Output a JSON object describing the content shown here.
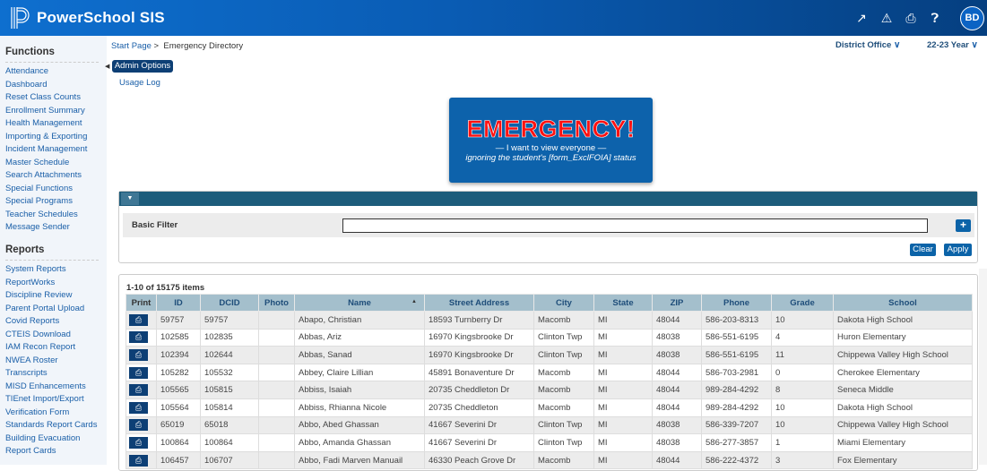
{
  "header": {
    "brand": "PowerSchool SIS",
    "icons": [
      "external-link-icon",
      "alert-icon",
      "print-icon",
      "help-icon"
    ],
    "avatar": "BD"
  },
  "sidebar": {
    "functions_title": "Functions",
    "functions": [
      "Attendance",
      "Dashboard",
      "Reset Class Counts",
      "Enrollment Summary",
      "Health Management",
      "Importing & Exporting",
      "Incident Management",
      "Master Schedule",
      "Search Attachments",
      "Special Functions",
      "Special Programs",
      "Teacher Schedules",
      "Message Sender"
    ],
    "reports_title": "Reports",
    "reports": [
      "System Reports",
      "ReportWorks",
      "Discipline Review",
      "Parent Portal Upload",
      "Covid Reports",
      "CTEIS Download",
      "IAM Recon Report",
      "NWEA Roster",
      "Transcripts",
      "MISD Enhancements",
      "TIEnet Import/Export",
      "Verification Form",
      "Standards Report Cards",
      "Building Evacuation",
      "Report Cards"
    ]
  },
  "breadcrumb": {
    "start": "Start Page",
    "sep": ">",
    "current": "Emergency Directory"
  },
  "context": {
    "school": "District Office",
    "year": "22-23 Year"
  },
  "admin_options": "Admin Options",
  "usage_log": "Usage Log",
  "banner": {
    "title": "EMERGENCY!",
    "line1": "— I want to view everyone —",
    "line2": "ignoring the student's [form_ExclFOIA] status"
  },
  "filter": {
    "label": "Basic Filter",
    "value": "",
    "add": "+",
    "clear": "Clear",
    "apply": "Apply"
  },
  "table": {
    "count": "1-10 of 15175 items",
    "columns": [
      "Print",
      "ID",
      "DCID",
      "Photo",
      "Name",
      "Street Address",
      "City",
      "State",
      "ZIP",
      "Phone",
      "Grade",
      "School"
    ],
    "sorted_column": "Name",
    "rows": [
      [
        "59757",
        "59757",
        "",
        "Abapo, Christian",
        "18593 Turnberry Dr",
        "Macomb",
        "MI",
        "48044",
        "586-203-8313",
        "10",
        "Dakota High School"
      ],
      [
        "102585",
        "102835",
        "",
        "Abbas, Ariz",
        "16970 Kingsbrooke Dr",
        "Clinton Twp",
        "MI",
        "48038",
        "586-551-6195",
        "4",
        "Huron Elementary"
      ],
      [
        "102394",
        "102644",
        "",
        "Abbas, Sanad",
        "16970 Kingsbrooke Dr",
        "Clinton Twp",
        "MI",
        "48038",
        "586-551-6195",
        "11",
        "Chippewa Valley High School"
      ],
      [
        "105282",
        "105532",
        "",
        "Abbey, Claire Lillian",
        "45891 Bonaventure Dr",
        "Macomb",
        "MI",
        "48044",
        "586-703-2981",
        "0",
        "Cherokee Elementary"
      ],
      [
        "105565",
        "105815",
        "",
        "Abbiss, Isaiah",
        "20735 Cheddleton Dr",
        "Macomb",
        "MI",
        "48044",
        "989-284-4292",
        "8",
        "Seneca Middle"
      ],
      [
        "105564",
        "105814",
        "",
        "Abbiss, Rhianna Nicole",
        "20735 Cheddleton",
        "Macomb",
        "MI",
        "48044",
        "989-284-4292",
        "10",
        "Dakota High School"
      ],
      [
        "65019",
        "65018",
        "",
        "Abbo, Abed Ghassan",
        "41667 Severini Dr",
        "Clinton Twp",
        "MI",
        "48038",
        "586-339-7207",
        "10",
        "Chippewa Valley High School"
      ],
      [
        "100864",
        "100864",
        "",
        "Abbo, Amanda Ghassan",
        "41667 Severini Dr",
        "Clinton Twp",
        "MI",
        "48038",
        "586-277-3857",
        "1",
        "Miami Elementary"
      ],
      [
        "106457",
        "106707",
        "",
        "Abbo, Fadi Marven Manuail",
        "46330 Peach Grove Dr",
        "Macomb",
        "MI",
        "48044",
        "586-222-4372",
        "3",
        "Fox Elementary"
      ]
    ]
  }
}
